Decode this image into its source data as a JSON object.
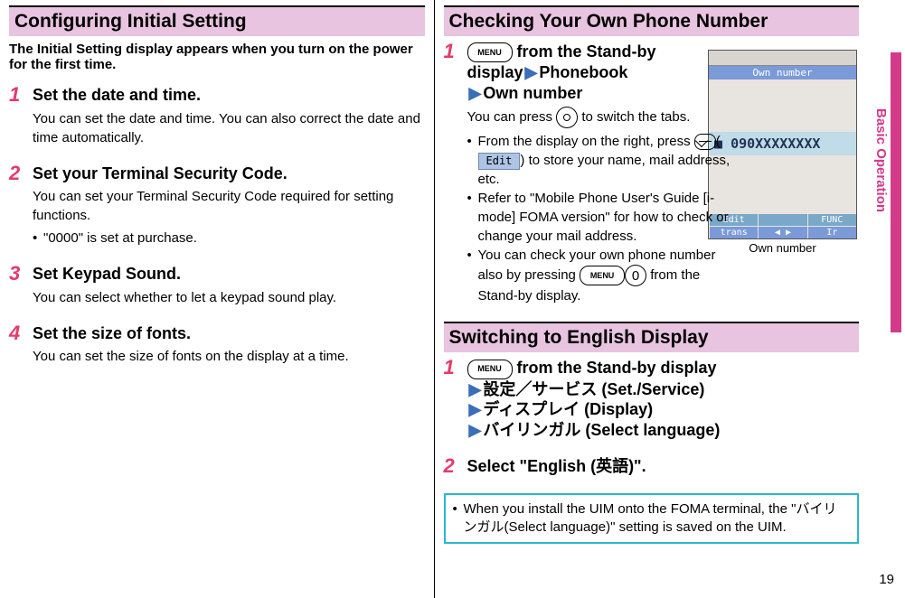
{
  "left": {
    "heading": "Configuring Initial Setting",
    "intro": "The Initial Setting display appears when you turn on the power for the first time.",
    "steps": [
      {
        "num": "1",
        "title": "Set the date and time.",
        "body": "You can set the date and time. You can also correct the date and time automatically."
      },
      {
        "num": "2",
        "title": "Set your Terminal Security Code.",
        "body": "You can set your Terminal Security Code required for setting functions.",
        "bullet": "\"0000\" is set at purchase."
      },
      {
        "num": "3",
        "title": "Set Keypad Sound.",
        "body": "You can select whether to let a keypad sound play."
      },
      {
        "num": "4",
        "title": "Set the size of fonts.",
        "body": "You can set the size of fonts on the display at a time."
      }
    ]
  },
  "right": {
    "heading1": "Checking Your Own Phone Number",
    "step1": {
      "num": "1",
      "menu": "MENU",
      "line1a": " from the Stand-by display",
      "arrow": "▶",
      "line1b": "Phonebook",
      "line2": "Own number",
      "body_a": "You can press ",
      "body_b": " to switch the tabs.",
      "b1a": "From the display on the right, press ",
      "edit": "Edit",
      "b1b": ") to store your name, mail address, etc.",
      "b2": "Refer to \"Mobile Phone User's Guide [i-mode] FOMA version\" for how to check or change your mail address.",
      "b3a": "You can check your own phone number also by pressing ",
      "zero": "0",
      "b3b": " from the Stand-by display."
    },
    "phone": {
      "title": "Own number",
      "num": "090XXXXXXXX",
      "sk_tl": "Edit",
      "sk_tr": "FUNC",
      "sk_bl": "trans",
      "sk_bm": "◀  ▶",
      "sk_br": "Ir",
      "caption": "Own number"
    },
    "heading2": "Switching to English Display",
    "sw_step1": {
      "num": "1",
      "line0": " from the Stand-by display",
      "line1": "設定／サービス (Set./Service)",
      "line2": "ディスプレイ (Display)",
      "line3": "バイリンガル (Select language)"
    },
    "sw_step2": {
      "num": "2",
      "title": "Select \"English (英語)\"."
    },
    "tip": "When you install the UIM onto the FOMA terminal, the \"バイリンガル(Select language)\" setting is saved on the UIM."
  },
  "side_label": "Basic Operation",
  "page_number": "19"
}
